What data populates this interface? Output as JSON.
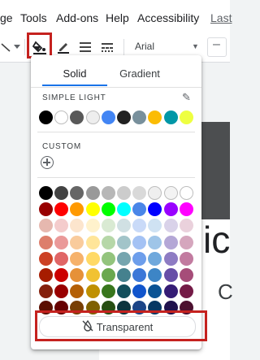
{
  "menu": {
    "items": [
      "ge",
      "Tools",
      "Add-ons",
      "Help",
      "Accessibility",
      "Last"
    ]
  },
  "toolbar": {
    "font_name": "Arial"
  },
  "popup": {
    "tabs": [
      "Solid",
      "Gradient"
    ],
    "active_tab": "Solid",
    "theme_label": "SIMPLE LIGHT",
    "custom_label": "CUSTOM",
    "theme_colors": [
      "#000000",
      "#ffffff",
      "#595959",
      "#eeeeee",
      "#4285f4",
      "#212121",
      "#78909c",
      "#fbbc04",
      "#0097a7",
      "#eeff41"
    ],
    "palette": [
      [
        "#000000",
        "#434343",
        "#666666",
        "#999999",
        "#b7b7b7",
        "#cccccc",
        "#d9d9d9",
        "#efefef",
        "#f3f3f3",
        "#ffffff"
      ],
      [
        "#980000",
        "#ff0000",
        "#ff9900",
        "#ffff00",
        "#00ff00",
        "#00ffff",
        "#4a86e8",
        "#0000ff",
        "#9900ff",
        "#ff00ff"
      ],
      [
        "#e6b8af",
        "#f4cccc",
        "#fce5cd",
        "#fff2cc",
        "#d9ead3",
        "#d0e0e3",
        "#c9daf8",
        "#cfe2f3",
        "#d9d2e9",
        "#ead1dc"
      ],
      [
        "#dd7e6b",
        "#ea9999",
        "#f9cb9c",
        "#ffe599",
        "#b6d7a8",
        "#a2c4c9",
        "#a4c2f4",
        "#9fc5e8",
        "#b4a7d6",
        "#d5a6bd"
      ],
      [
        "#cc4125",
        "#e06666",
        "#f6b26b",
        "#ffd966",
        "#93c47d",
        "#76a5af",
        "#6d9eeb",
        "#6fa8dc",
        "#8e7cc3",
        "#c27ba0"
      ],
      [
        "#a61c00",
        "#cc0000",
        "#e69138",
        "#f1c232",
        "#6aa84f",
        "#45818e",
        "#3c78d8",
        "#3d85c6",
        "#674ea7",
        "#a64d79"
      ],
      [
        "#85200c",
        "#990000",
        "#b45f06",
        "#bf9000",
        "#38761d",
        "#134f5c",
        "#1155cc",
        "#0b5394",
        "#351c75",
        "#741b47"
      ],
      [
        "#5b0f00",
        "#660000",
        "#783f04",
        "#7f6000",
        "#274e13",
        "#0c343d",
        "#1c4587",
        "#073763",
        "#20124d",
        "#4c1130"
      ]
    ],
    "transparent_label": "Transparent"
  },
  "slide": {
    "glyph_large": "ic",
    "glyph_small": "C"
  },
  "colors": {
    "highlight": "#c5221f",
    "accent": "#1a73e8"
  }
}
